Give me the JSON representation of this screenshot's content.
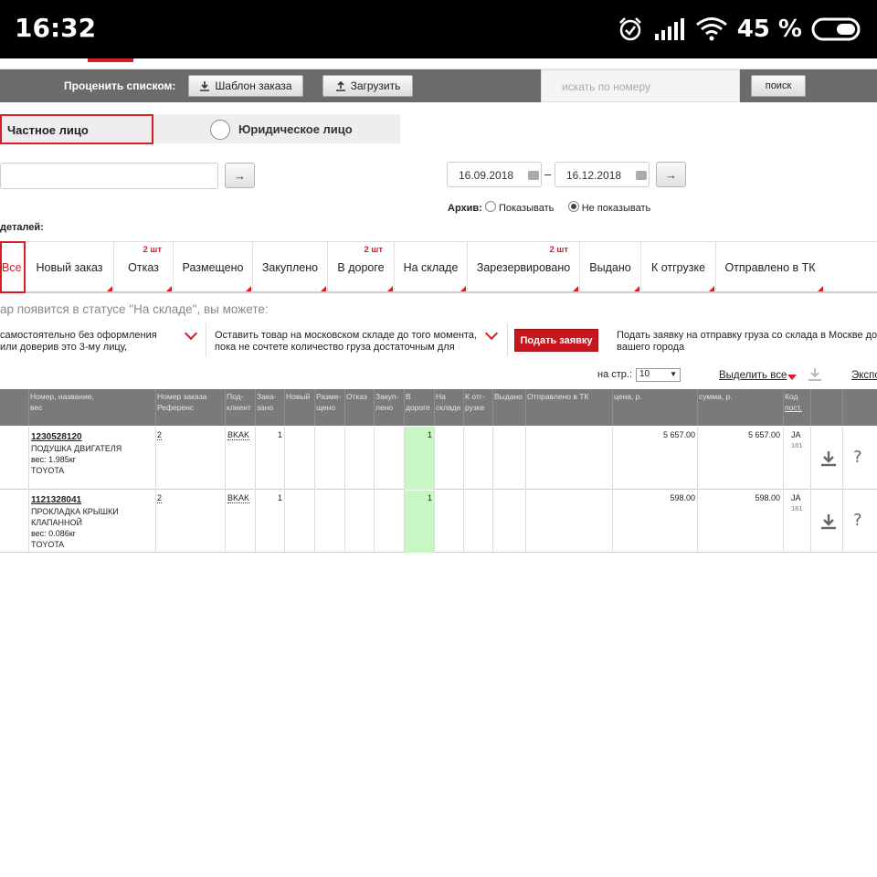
{
  "status_bar": {
    "time": "16:32",
    "battery": "45 %"
  },
  "toolbar": {
    "price_list_label": "Проценить списком:",
    "template_button": "Шаблон заказа",
    "upload_button": "Загрузить",
    "search_placeholder": "искать по номеру",
    "search_button": "поиск"
  },
  "customer_type": {
    "private": "Частное лицо",
    "legal": "Юридическое лицо"
  },
  "filters": {
    "arrow": "→",
    "date_from": "16.09.2018",
    "date_to": "16.12.2018",
    "dash": "–",
    "archive_label": "Архив:",
    "archive_show": "Показывать",
    "archive_hide": "Не показывать",
    "details_label": "деталей:"
  },
  "status_tabs": [
    {
      "label": "Все",
      "count": ""
    },
    {
      "label": "Новый заказ",
      "count": ""
    },
    {
      "label": "Отказ",
      "count": "2 шт"
    },
    {
      "label": "Размещено",
      "count": ""
    },
    {
      "label": "Закуплено",
      "count": ""
    },
    {
      "label": "В дороге",
      "count": "2 шт"
    },
    {
      "label": "На складе",
      "count": ""
    },
    {
      "label": "Зарезервировано",
      "count": "2 шт"
    },
    {
      "label": "Выдано",
      "count": ""
    },
    {
      "label": "К отгрузке",
      "count": ""
    },
    {
      "label": "Отправлено в ТК",
      "count": ""
    }
  ],
  "info": {
    "title": "ар появится в статусе \"На складе\", вы можете:",
    "option1_line1": "самостоятельно без оформления",
    "option1_line2": "или доверив это 3-му лицу,",
    "option2_line1": "Оставить товар на московском складе до того момента,",
    "option2_line2": "пока не сочтете количество груза достаточным для",
    "submit_button": "Подать заявку",
    "option3_line1": "Подать заявку на отправку груза со склада в Москве до",
    "option3_line2": "вашего города"
  },
  "pager": {
    "per_page_label": "на стр.:",
    "per_page_value": "10",
    "select_all": "Выделить все",
    "export": "Экспо"
  },
  "table": {
    "headers": {
      "name": [
        "Номер, название,",
        "вес"
      ],
      "ref": [
        "Номер заказа",
        "Референс"
      ],
      "client": [
        "Под-",
        "клиент"
      ],
      "ordered": [
        "Зака-",
        "зано"
      ],
      "new": [
        "Новый"
      ],
      "placed": [
        "Разме-",
        "щено"
      ],
      "refused": [
        "Отказ"
      ],
      "bought": [
        "Закуп-",
        "лено"
      ],
      "transit": [
        "В",
        "дороге"
      ],
      "warehouse": [
        "На",
        "складе"
      ],
      "to_ship": [
        "К отг-",
        "рузке"
      ],
      "issued": [
        "Выдано"
      ],
      "sent_tk": [
        "Отправлено в ТК"
      ],
      "price": [
        "цена, р."
      ],
      "sum": [
        "сумма, р."
      ],
      "supplier": [
        "Код",
        "пост."
      ]
    },
    "rows": [
      {
        "part_no": "1230528120",
        "name": "ПОДУШКА ДВИГАТЕЛЯ",
        "name2": "",
        "weight": "вес: 1.985кг",
        "brand": "TOYOTA",
        "ref": "2",
        "client": "BKAK",
        "ordered": "1",
        "transit": "1",
        "price": "5 657.00",
        "sum": "5 657.00",
        "supplier": "JA",
        "supplier_code": "161"
      },
      {
        "part_no": "1121328041",
        "name": "ПРОКЛАДКА КРЫШКИ",
        "name2": "КЛАПАННОЙ",
        "weight": "вес: 0.086кг",
        "brand": "TOYOTA",
        "ref": "2",
        "client": "BKAK",
        "ordered": "1",
        "transit": "1",
        "price": "598.00",
        "sum": "598.00",
        "supplier": "JA",
        "supplier_code": "161"
      }
    ],
    "help": "?"
  },
  "colors": {
    "accent": "#d81e25",
    "header_gray": "#7a7a7a",
    "highlight": "#c9f7c4"
  }
}
